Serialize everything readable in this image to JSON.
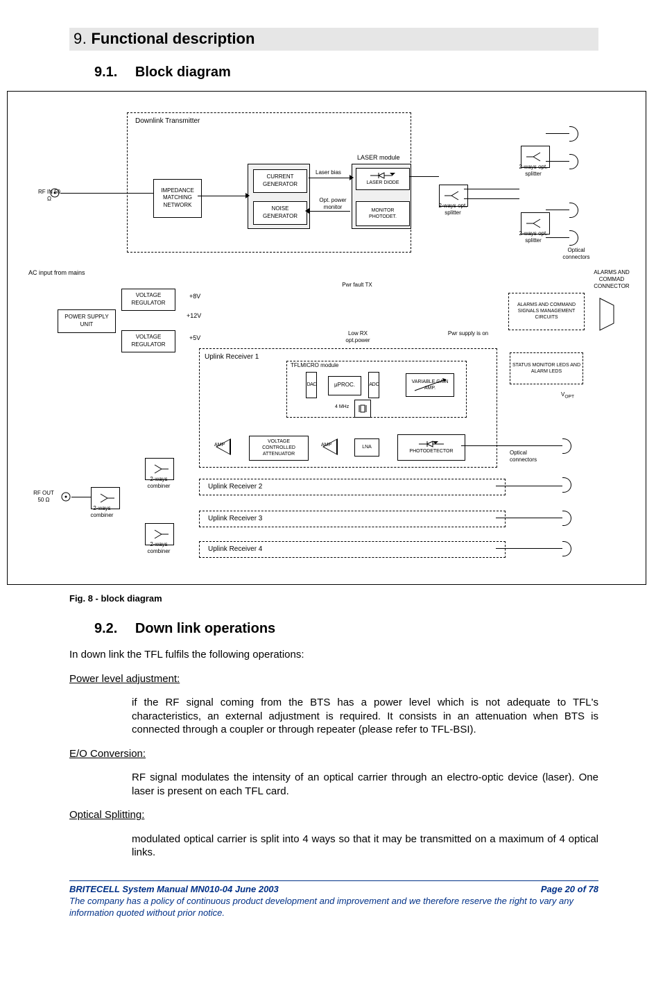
{
  "headings": {
    "h1_num": "9.",
    "h1_title": "Functional description",
    "h2a_num": "9.1.",
    "h2a_title": "Block diagram",
    "h2b_num": "9.2.",
    "h2b_title": "Down link operations"
  },
  "caption": "Fig. 8 - block diagram",
  "diagram": {
    "downlink_tx": "Downlink Transmitter",
    "impedance": "IMPEDANCE MATCHING NETWORK",
    "current_gen": "CURRENT GENERATOR",
    "noise_gen": "NOISE GENERATOR",
    "laser_bias": "Laser bias",
    "opt_power": "Opt. power monitor",
    "laser_module": "LASER module",
    "laser_diode": "LASER DIODE",
    "monitor_phot": "MONITOR PHOTODET.",
    "splitter2w": "2-ways opt. splitter",
    "optical_conn": "Optical connectors",
    "rf_in": "RF IN 50 Ω",
    "rf_out": "RF OUT 50 Ω",
    "ac_input": "AC input from mains",
    "psu": "POWER SUPPLY UNIT",
    "volt_reg": "VOLTAGE REGULATOR",
    "v8": "+8V",
    "v12": "+12V",
    "v5": "+5V",
    "pwr_fault": "Pwr fault TX",
    "low_rx": "Low RX opt.power",
    "pwr_on": "Pwr supply is on",
    "alarms_conn": "ALARMS AND COMMAD CONNECTOR",
    "alarms_mgmt": "ALARMS AND COMMAND SIGNALS MANAGEMENT CIRCUITS",
    "status_leds": "STATUS MONITOR LEDS AND ALARM LEDS",
    "vopt": "V",
    "vopt_sub": "OPT",
    "uplink1": "Uplink Receiver 1",
    "uplink2": "Uplink Receiver 2",
    "uplink3": "Uplink Receiver 3",
    "uplink4": "Uplink Receiver 4",
    "tflmicro": "TFLMICRO module",
    "dac": "D A C",
    "adc": "A D C",
    "uproc": "μPROC.",
    "varamp": "VARIABLE GAIN AMP.",
    "mhz4": "4 MHz",
    "amp": "AMP",
    "vca": "VOLTAGE CONTROLLED ATTENUATOR",
    "lna": "LNA",
    "photodet": "PHOTODETECTOR",
    "combiner": "2-ways combiner"
  },
  "text": {
    "intro": "In down link the TFL fulfils the following operations:",
    "pla_h": "Power level adjustment:",
    "pla_b": "if the RF signal coming from the BTS has a power level which is not adequate to TFL's characteristics, an external adjustment is required. It consists in an attenuation when BTS is connected through a coupler or through repeater (please refer to TFL-BSI).",
    "eo_h": "E/O Conversion:",
    "eo_b": "RF signal modulates the intensity of an optical carrier through an electro-optic device (laser). One laser is present on each TFL card.",
    "os_h": "Optical Splitting:",
    "os_b": "modulated optical carrier is split into 4 ways so that it may be transmitted on a maximum of 4 optical links."
  },
  "footer": {
    "left": "BRITECELL System Manual MN010-04 June 2003",
    "right": "Page 20 of  78",
    "disclaimer": "The company has a policy of continuous product development and improvement and we therefore reserve  the right to vary any information quoted without prior notice."
  }
}
